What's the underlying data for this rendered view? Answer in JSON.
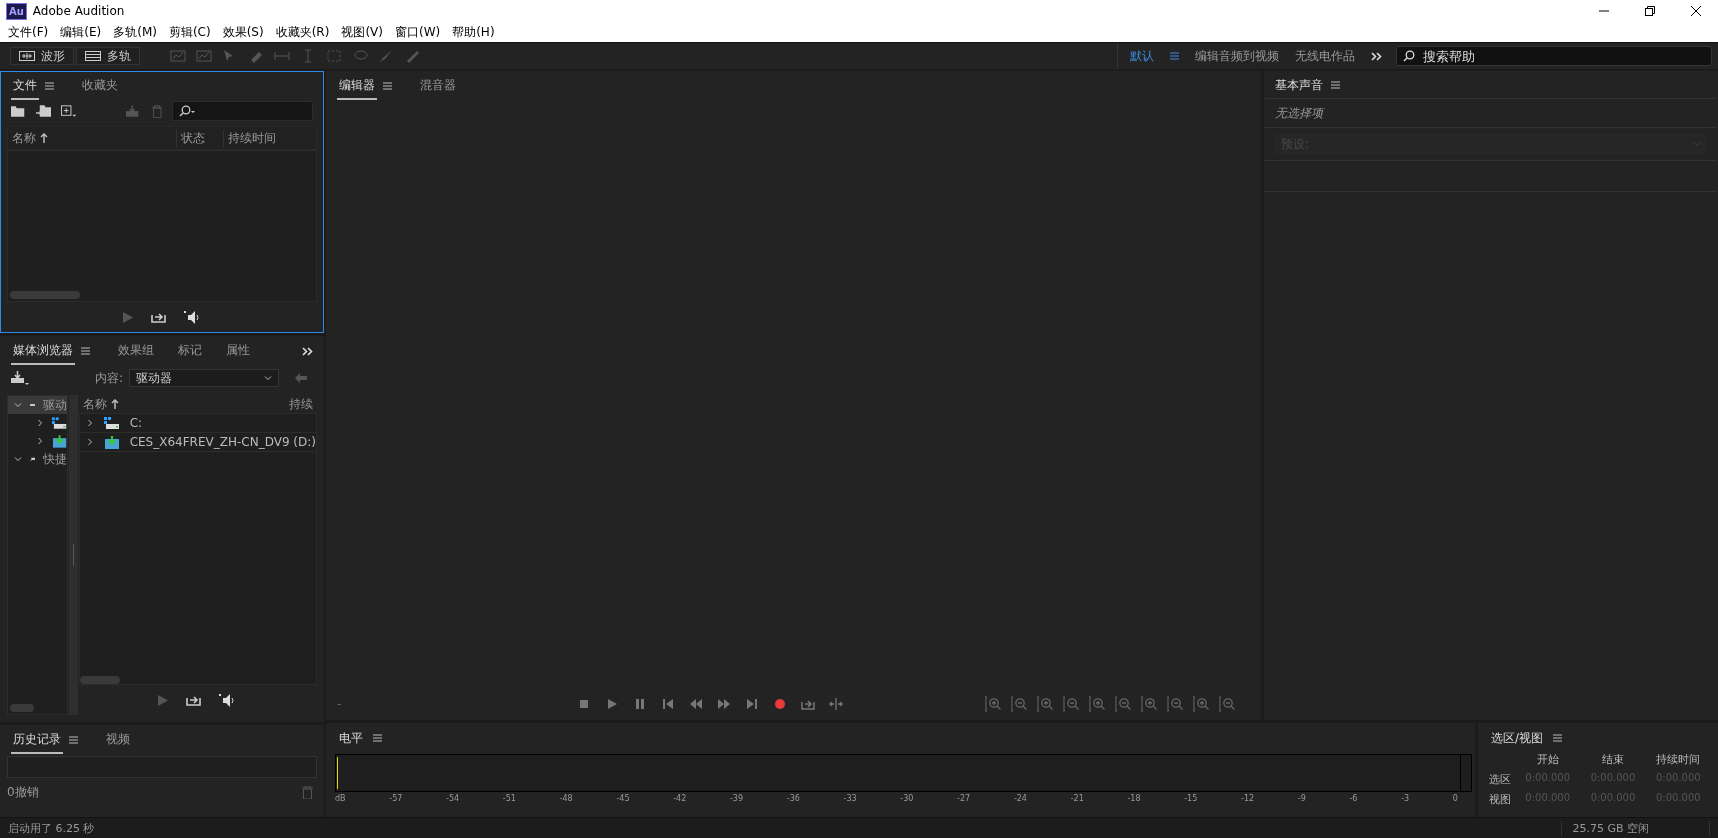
{
  "window": {
    "title": "Adobe Audition",
    "app_badge": "Au"
  },
  "menu": [
    "文件(F)",
    "编辑(E)",
    "多轨(M)",
    "剪辑(C)",
    "效果(S)",
    "收藏夹(R)",
    "视图(V)",
    "窗口(W)",
    "帮助(H)"
  ],
  "toolbar": {
    "modes": [
      {
        "label": "波形",
        "kind": "waveform"
      },
      {
        "label": "多轨",
        "kind": "multitrack"
      }
    ]
  },
  "workspaces": [
    {
      "label": "默认",
      "selected": true
    },
    {
      "label": "编辑音频到视频",
      "selected": false
    },
    {
      "label": "无线电作品",
      "selected": false
    }
  ],
  "help_search": {
    "placeholder": "搜索帮助"
  },
  "files_panel": {
    "active": true,
    "tabs": [
      {
        "label": "文件",
        "selected": true
      },
      {
        "label": "收藏夹",
        "selected": false
      }
    ],
    "columns": [
      "名称",
      "状态",
      "持续时间"
    ]
  },
  "media_panel": {
    "tabs": [
      {
        "label": "媒体浏览器",
        "selected": true
      },
      {
        "label": "效果组",
        "selected": false
      },
      {
        "label": "标记",
        "selected": false
      },
      {
        "label": "属性",
        "selected": false
      }
    ],
    "content_label": "内容:",
    "content_value": "驱动器",
    "tree": [
      {
        "label": "驱动",
        "kind": "drives",
        "expanded": true,
        "selected": true,
        "children": [
          {
            "kind": "windows-drive",
            "expanded": false
          },
          {
            "kind": "dvd-drive",
            "expanded": false
          }
        ]
      },
      {
        "label": "快捷",
        "kind": "shortcuts",
        "expanded": true,
        "selected": false
      }
    ],
    "list_columns": [
      "名称",
      "持续"
    ],
    "list": [
      {
        "label": "C:",
        "kind": "windows-drive",
        "expanded": false
      },
      {
        "label": "CES_X64FREV_ZH-CN_DV9 (D:)",
        "kind": "dvd-drive",
        "expanded": false
      }
    ]
  },
  "history_panel": {
    "tabs": [
      {
        "label": "历史记录",
        "selected": true
      },
      {
        "label": "视频",
        "selected": false
      }
    ],
    "undo_count": "0撤销"
  },
  "editor": {
    "tabs": [
      {
        "label": "编辑器",
        "selected": true
      },
      {
        "label": "混音器",
        "selected": false
      }
    ],
    "time": "-"
  },
  "basic_sound": {
    "title": "基本声音",
    "status": "无选择项",
    "preset_label": "预设:",
    "preset_disabled": true
  },
  "levels": {
    "title": "电平",
    "scale": [
      "dB",
      "-57",
      "-54",
      "-51",
      "-48",
      "-45",
      "-42",
      "-39",
      "-36",
      "-33",
      "-30",
      "-27",
      "-24",
      "-21",
      "-18",
      "-15",
      "-12",
      "-9",
      "-6",
      "-3",
      "0"
    ]
  },
  "selection_view": {
    "title": "选区/视图",
    "columns": [
      "开始",
      "结束",
      "持续时间"
    ],
    "rows": [
      {
        "label": "选区",
        "cells": [
          "0:00.000",
          "0:00.000",
          "0:00.000"
        ]
      },
      {
        "label": "视图",
        "cells": [
          "0:00.000",
          "0:00.000",
          "0:00.000"
        ]
      }
    ]
  },
  "status_bar": {
    "message": "启动用了 6.25 秒",
    "disk_free": "25.75 GB 空闲"
  }
}
